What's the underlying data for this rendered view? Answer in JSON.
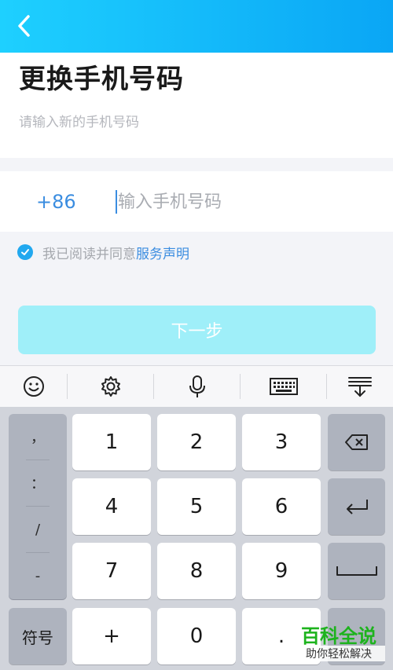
{
  "header": {
    "title": "更换手机号码",
    "subtitle": "请输入新的手机号码"
  },
  "phone": {
    "country_code": "+86",
    "placeholder": "输入手机号码",
    "value": ""
  },
  "agreement": {
    "checked": true,
    "text": "我已阅读并同意",
    "link": "服务声明"
  },
  "next_button": {
    "label": "下一步",
    "enabled": false
  },
  "keyboard": {
    "toolbar_icons": [
      "emoji-icon",
      "settings-icon",
      "microphone-icon",
      "keyboard-icon",
      "collapse-keyboard-icon"
    ],
    "symbols": [
      "，",
      "：",
      "/",
      "-"
    ],
    "symbol_key": "符号",
    "digits": [
      "1",
      "2",
      "3",
      "4",
      "5",
      "6",
      "7",
      "8",
      "9",
      "+",
      "0",
      "."
    ]
  },
  "watermark": {
    "brand": "百科全说",
    "slogan": "助你轻松解决"
  },
  "colors": {
    "topbar_start": "#1ed0ff",
    "topbar_end": "#0aa6f5",
    "link": "#3b8de0",
    "button_disabled": "#9feff9"
  }
}
